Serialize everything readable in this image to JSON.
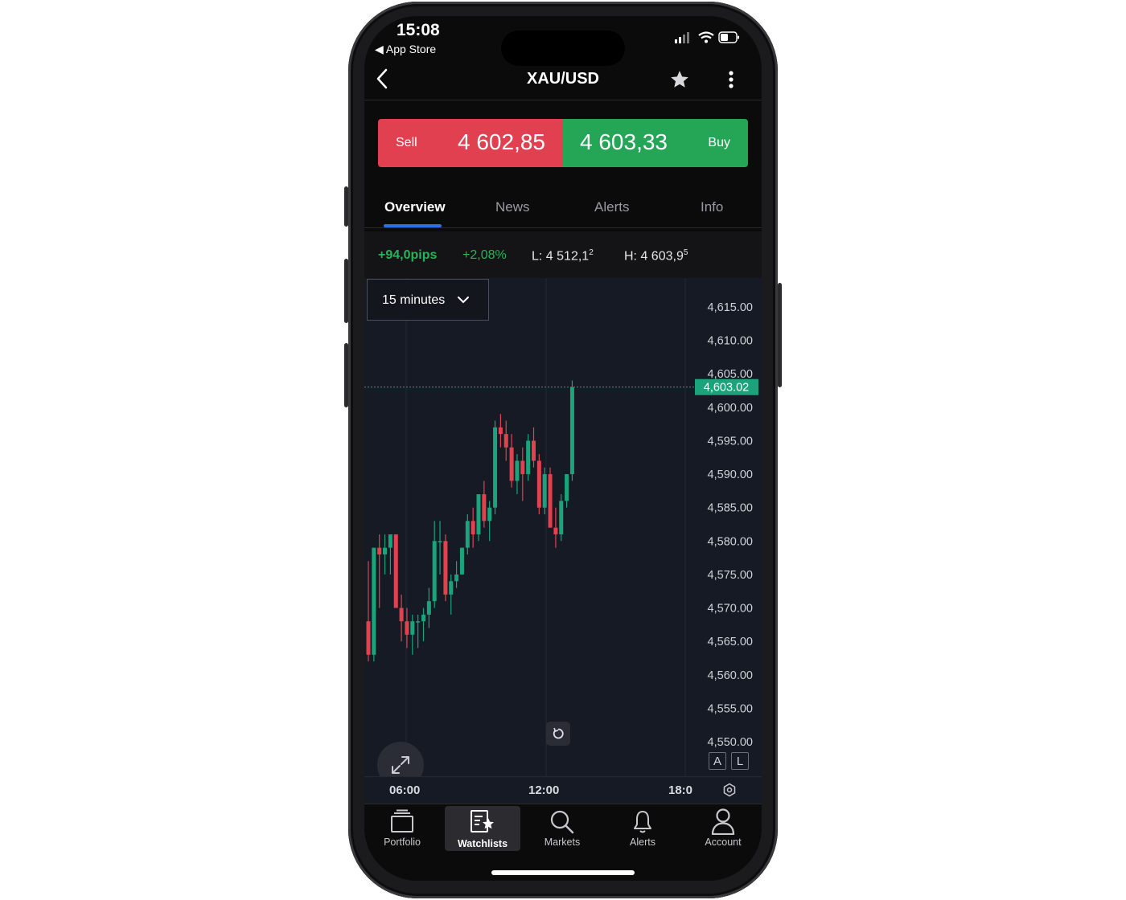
{
  "status_bar": {
    "time": "15:08",
    "back_app": "◀ App Store"
  },
  "header": {
    "title": "XAU/USD"
  },
  "trade": {
    "sell_label": "Sell",
    "sell_price": "4 602,85",
    "buy_price": "4 603,33",
    "buy_label": "Buy"
  },
  "tabs": [
    {
      "label": "Overview"
    },
    {
      "label": "News"
    },
    {
      "label": "Alerts"
    },
    {
      "label": "Info"
    }
  ],
  "stats": {
    "pips": "+94,0pips",
    "percent": "+2,08%",
    "low_label": "L:",
    "low_value": "4 512,1",
    "low_sup": "2",
    "high_label": "H:",
    "high_value": "4 603,9",
    "high_sup": "5"
  },
  "timeframe": {
    "selected": "15 minutes"
  },
  "scale_buttons": {
    "auto": "A",
    "log": "L"
  },
  "colors": {
    "up": "#1ba37c",
    "down": "#e1424f",
    "sell": "#e0404f",
    "buy": "#25a657",
    "accent": "#2f6ee6"
  },
  "chart_data": {
    "type": "candlestick",
    "y_ticks": [
      "4,615.00",
      "4,610.00",
      "4,605.00",
      "4,600.00",
      "4,595.00",
      "4,590.00",
      "4,585.00",
      "4,580.00",
      "4,575.00",
      "4,570.00",
      "4,565.00",
      "4,560.00",
      "4,555.00",
      "4,550.00"
    ],
    "x_ticks": [
      "06:00",
      "12:00",
      "18:0"
    ],
    "current_price": "4,603.02",
    "current_value": 4603.02,
    "ohlc": [
      [
        4568,
        4577,
        4562,
        4563
      ],
      [
        4563,
        4579,
        4562,
        4579
      ],
      [
        4579,
        4581,
        4570,
        4578
      ],
      [
        4578,
        4581,
        4575,
        4579
      ],
      [
        4579,
        4581,
        4575,
        4581
      ],
      [
        4581,
        4581,
        4570,
        4570
      ],
      [
        4570,
        4572,
        4565,
        4568
      ],
      [
        4568,
        4570,
        4564,
        4566
      ],
      [
        4566,
        4569,
        4563,
        4568
      ],
      [
        4568,
        4569,
        4564,
        4568
      ],
      [
        4568,
        4570,
        4565,
        4569
      ],
      [
        4569,
        4573,
        4567,
        4571
      ],
      [
        4571,
        4583,
        4570,
        4580
      ],
      [
        4580,
        4583,
        4575,
        4580
      ],
      [
        4580,
        4581,
        4571,
        4572
      ],
      [
        4572,
        4575,
        4569,
        4574
      ],
      [
        4574,
        4577,
        4573,
        4575
      ],
      [
        4575,
        4579,
        4575,
        4579
      ],
      [
        4579,
        4584,
        4578,
        4583
      ],
      [
        4583,
        4585,
        4579,
        4581
      ],
      [
        4581,
        4587,
        4580,
        4587
      ],
      [
        4587,
        4589,
        4582,
        4583
      ],
      [
        4583,
        4586,
        4580,
        4585
      ],
      [
        4585,
        4598,
        4584,
        4597
      ],
      [
        4597,
        4599,
        4594,
        4596
      ],
      [
        4596,
        4598,
        4592,
        4594
      ],
      [
        4594,
        4596,
        4588,
        4589
      ],
      [
        4589,
        4593,
        4587,
        4592
      ],
      [
        4592,
        4594,
        4586,
        4590
      ],
      [
        4590,
        4596,
        4589,
        4595
      ],
      [
        4595,
        4597,
        4591,
        4592
      ],
      [
        4592,
        4593,
        4584,
        4585
      ],
      [
        4585,
        4591,
        4584,
        4590
      ],
      [
        4590,
        4591,
        4582,
        4582
      ],
      [
        4582,
        4585,
        4579,
        4581
      ],
      [
        4581,
        4587,
        4580,
        4586
      ],
      [
        4586,
        4590,
        4585,
        4590
      ],
      [
        4590,
        4604,
        4589,
        4603
      ]
    ],
    "ylim": [
      4546,
      4619
    ]
  },
  "tabbar": [
    {
      "label": "Portfolio",
      "icon": "portfolio-icon"
    },
    {
      "label": "Watchlists",
      "icon": "watchlists-icon"
    },
    {
      "label": "Markets",
      "icon": "search-icon"
    },
    {
      "label": "Alerts",
      "icon": "bell-icon"
    },
    {
      "label": "Account",
      "icon": "person-icon"
    }
  ]
}
